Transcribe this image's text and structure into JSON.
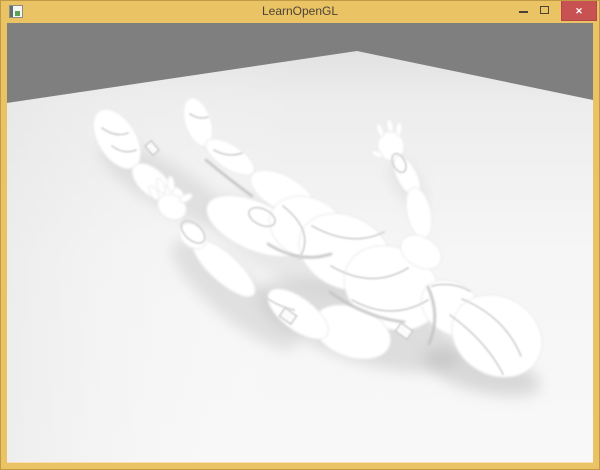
{
  "window": {
    "title": "LearnOpenGL",
    "icons": {
      "app": "app-window-icon",
      "minimize": "dash",
      "maximize": "box-outline",
      "close": "✕"
    },
    "colors": {
      "titlebar": "#eac365",
      "titlebar_edge": "#c09a44",
      "title_text": "#4a4336",
      "control_glyph": "#4a4336",
      "close_bg": "#c85252",
      "close_border": "#b34747",
      "close_glyph": "#ffffff"
    }
  },
  "viewport": {
    "colors": {
      "background": "#7f7f7f",
      "floor": "#f4f4f4",
      "model": "#ffffff",
      "shadow": "#b4b4b4"
    }
  }
}
